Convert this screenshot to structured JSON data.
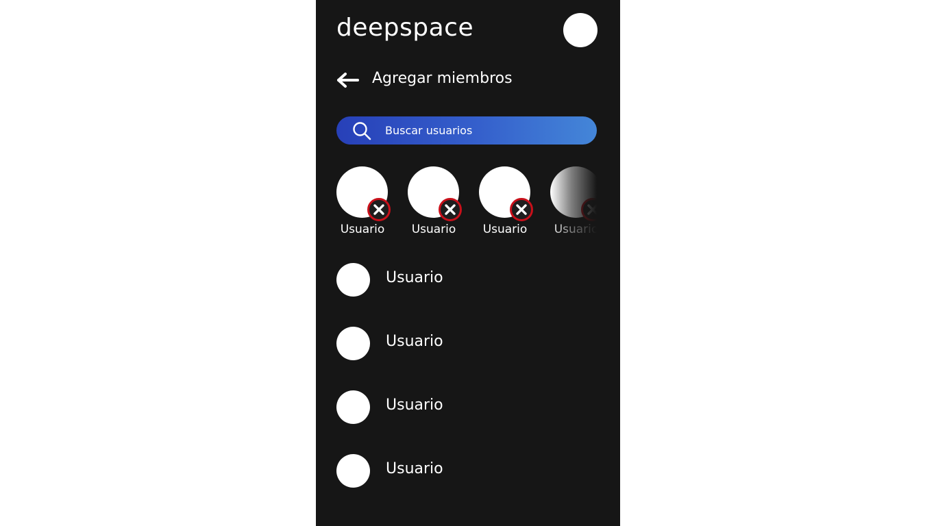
{
  "app": {
    "brand": "deepspace"
  },
  "header": {
    "title": "Agregar miembros",
    "back_icon": "arrow-left-icon"
  },
  "search": {
    "placeholder": "Buscar usuarios",
    "value": "",
    "icon": "search-icon"
  },
  "selected_members": [
    {
      "name": "Usuario"
    },
    {
      "name": "Usuario"
    },
    {
      "name": "Usuario"
    },
    {
      "name": "Usuario"
    }
  ],
  "users": [
    {
      "name": "Usuario"
    },
    {
      "name": "Usuario"
    },
    {
      "name": "Usuario"
    },
    {
      "name": "Usuario"
    }
  ],
  "colors": {
    "background": "#161616",
    "search_gradient_start": "#2740b8",
    "search_gradient_end": "#4486d8",
    "remove_ring": "#c8101a"
  }
}
